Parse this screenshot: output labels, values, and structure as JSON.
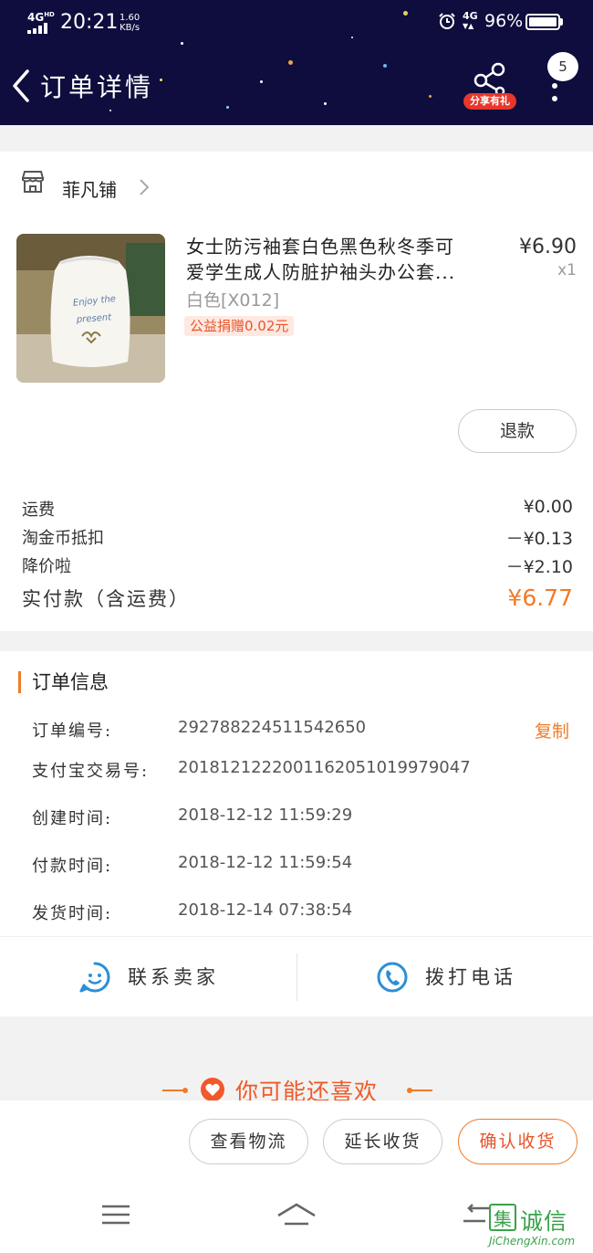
{
  "status_bar": {
    "network": "4G",
    "network_sup": "HD",
    "time": "20:21",
    "speed_value": "1.60",
    "speed_unit": "KB/s",
    "network_right": "4G",
    "battery": "96%"
  },
  "header": {
    "title": "订单详情",
    "share_label": "分享有礼",
    "notification_count": "5"
  },
  "shop": {
    "name": "菲凡铺"
  },
  "product": {
    "title_line1": "女士防污袖套白色黑色秋冬季可",
    "title_line2": "爱学生成人防脏护袖头办公套...",
    "variant": "白色[X012]",
    "charity": "公益捐赠0.02元",
    "price": "¥6.90",
    "quantity": "x1",
    "refund_label": "退款",
    "image_text_line1": "Enjoy the",
    "image_text_line2": "present"
  },
  "fees": {
    "shipping_label": "运费",
    "shipping_value": "¥0.00",
    "coin_label": "淘金币抵扣",
    "coin_value": "－¥0.13",
    "discount_label": "降价啦",
    "discount_value": "－¥2.10",
    "total_label": "实付款（含运费）",
    "total_value": "¥6.77"
  },
  "order_info": {
    "section_title": "订单信息",
    "copy_label": "复制",
    "rows": [
      {
        "key": "订单编号:",
        "value": "292788224511542650"
      },
      {
        "key": "支付宝交易号:",
        "value": "2018121222001162051019979047"
      },
      {
        "key": "创建时间:",
        "value": "2018-12-12 11:59:29"
      },
      {
        "key": "付款时间:",
        "value": "2018-12-12 11:59:54"
      },
      {
        "key": "发货时间:",
        "value": "2018-12-14 07:38:54"
      }
    ]
  },
  "contact": {
    "seller_label": "联系卖家",
    "call_label": "拨打电话"
  },
  "recommend": {
    "title": "你可能还喜欢"
  },
  "actions": {
    "logistics": "查看物流",
    "extend": "延长收货",
    "confirm": "确认收货"
  },
  "watermark": {
    "box_char": "集",
    "text": "诚信",
    "url": "JiChengXin.com"
  },
  "colors": {
    "header_bg": "#0e0d3e",
    "accent_orange": "#f27a26",
    "share_red": "#e8362b"
  }
}
